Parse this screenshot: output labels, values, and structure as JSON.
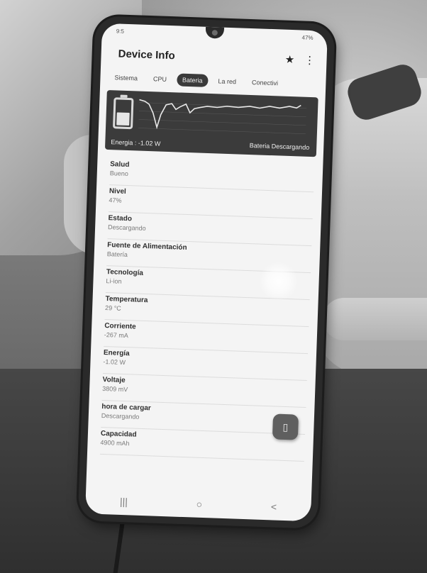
{
  "statusbar": {
    "left": "9:5",
    "right": "47%"
  },
  "appbar": {
    "title": "Device Info",
    "star_icon": "star-icon",
    "menu_icon": "more-vert-icon"
  },
  "tabs": [
    {
      "label": "Sistema",
      "active": false
    },
    {
      "label": "CPU",
      "active": false
    },
    {
      "label": "Bateria",
      "active": true
    },
    {
      "label": "La red",
      "active": false
    },
    {
      "label": "Conectivi",
      "active": false
    }
  ],
  "graph": {
    "energy_text": "Energia : -1.02 W",
    "status_text": "Bateria Descargando",
    "battery_level_percent": 47,
    "colors": {
      "background": "#3b3b3b",
      "line": "#e8e8e8"
    }
  },
  "info": [
    {
      "label": "Salud",
      "value": "Bueno"
    },
    {
      "label": "Nivel",
      "value": "47%"
    },
    {
      "label": "Estado",
      "value": "Descargando"
    },
    {
      "label": "Fuente de Alimentación",
      "value": "Batería"
    },
    {
      "label": "Tecnología",
      "value": "Li-ion"
    },
    {
      "label": "Temperatura",
      "value": "29 °C"
    },
    {
      "label": "Corriente",
      "value": "-267 mA"
    },
    {
      "label": "Energía",
      "value": "-1.02 W"
    },
    {
      "label": "Voltaje",
      "value": "3809 mV"
    },
    {
      "label": "hora de cargar",
      "value": "Descargando"
    },
    {
      "label": "Capacidad",
      "value": "4900 mAh"
    }
  ],
  "fab": {
    "icon": "battery-icon"
  },
  "navbar": {
    "recent": "|||",
    "home": "○",
    "back": "<"
  }
}
